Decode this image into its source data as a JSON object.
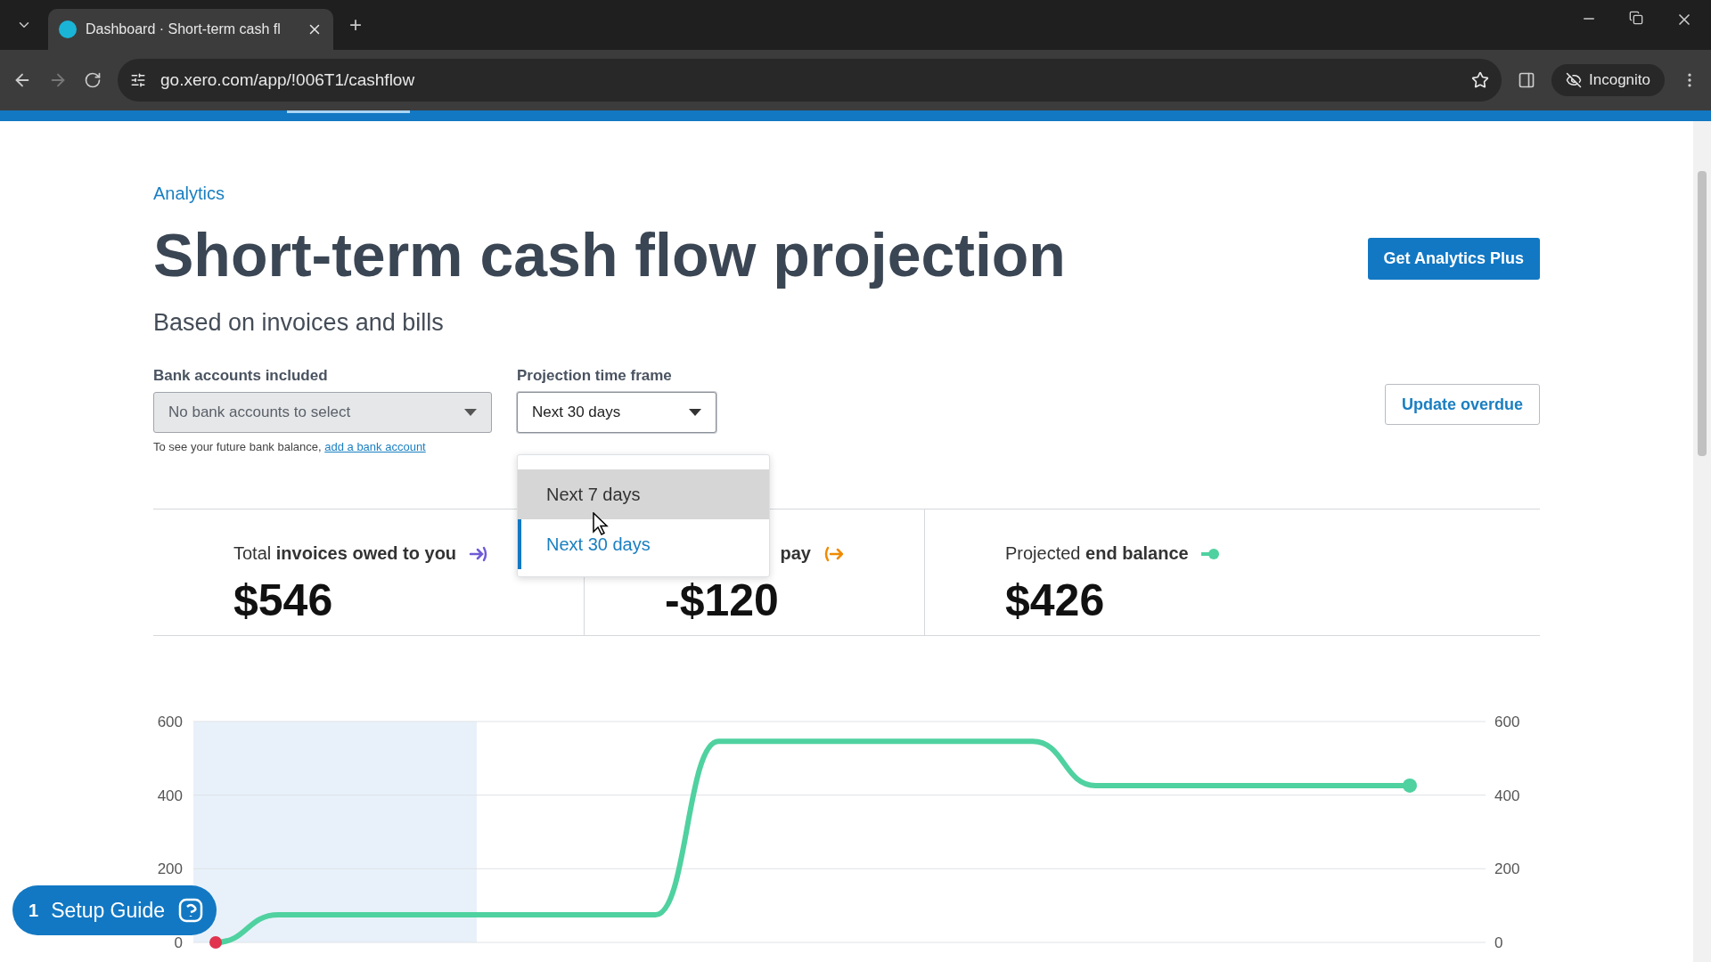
{
  "browser": {
    "tab_title": "Dashboard · Short-term cash fl",
    "new_tab": "+",
    "url": "go.xero.com/app/!006T1/cashflow",
    "profile": "Incognito"
  },
  "breadcrumb": "Analytics",
  "title": "Short-term cash flow projection",
  "subtitle": "Based on invoices and bills",
  "cta_button": "Get Analytics Plus",
  "bank_select": {
    "label": "Bank accounts included",
    "value": "No bank accounts to select",
    "disabled": true,
    "hint": "To see your future bank balance,",
    "hint_link": "add a bank account"
  },
  "timeframe_select": {
    "label": "Projection time frame",
    "value": "Next 30 days",
    "expanded": true,
    "options": [
      {
        "label": "Next 7 days",
        "selected": false,
        "hovered": true
      },
      {
        "label": "Next 30 days",
        "selected": true,
        "hovered": false
      }
    ]
  },
  "update_button": "Update overdue",
  "summary": [
    {
      "label": "Total **invoices owed to you**",
      "value": "$546",
      "kind": "in",
      "color": "#6f5bd8"
    },
    {
      "label": "**pay**",
      "value": "-$120",
      "kind": "out",
      "color": "#f08a00"
    },
    {
      "label": "Projected **end balance**",
      "value": "$426",
      "kind": "balance",
      "color": "#4fd1a0"
    }
  ],
  "chart_data": {
    "type": "line",
    "ylim": [
      0,
      600
    ],
    "yticks": [
      0,
      200,
      400,
      600
    ],
    "y2ticks": [
      0,
      200,
      400,
      600
    ],
    "y2lim": [
      0,
      600
    ],
    "series": [
      {
        "color": "#4fd1a0",
        "values": [
          0,
          75,
          75,
          75,
          75,
          75,
          75,
          75,
          546,
          546,
          546,
          546,
          546,
          546,
          426,
          426,
          426,
          426,
          426,
          426
        ]
      }
    ]
  },
  "setup_guide": {
    "count": "1",
    "label": "Setup Guide"
  }
}
